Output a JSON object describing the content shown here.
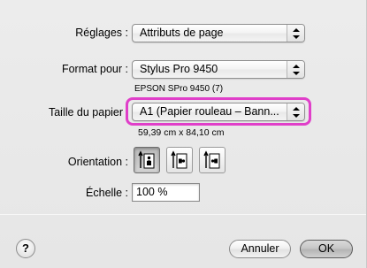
{
  "settings": {
    "label": "Réglages :",
    "value": "Attributs de page"
  },
  "format": {
    "label": "Format pour :",
    "value": "Stylus Pro 9450",
    "subtitle": "EPSON SPro 9450 (7)"
  },
  "paper": {
    "label": "Taille du papier :",
    "value": "A1 (Papier rouleau – Bann...",
    "dimensions": "59,39 cm x 84,10 cm",
    "highlight_color": "#e03fc9"
  },
  "orientation": {
    "label": "Orientation :",
    "options": [
      "portrait-icon",
      "landscape-left-icon",
      "landscape-right-icon"
    ]
  },
  "scale": {
    "label": "Échelle :",
    "value": "100 %"
  },
  "footer": {
    "help": "?",
    "cancel": "Annuler",
    "ok": "OK"
  }
}
